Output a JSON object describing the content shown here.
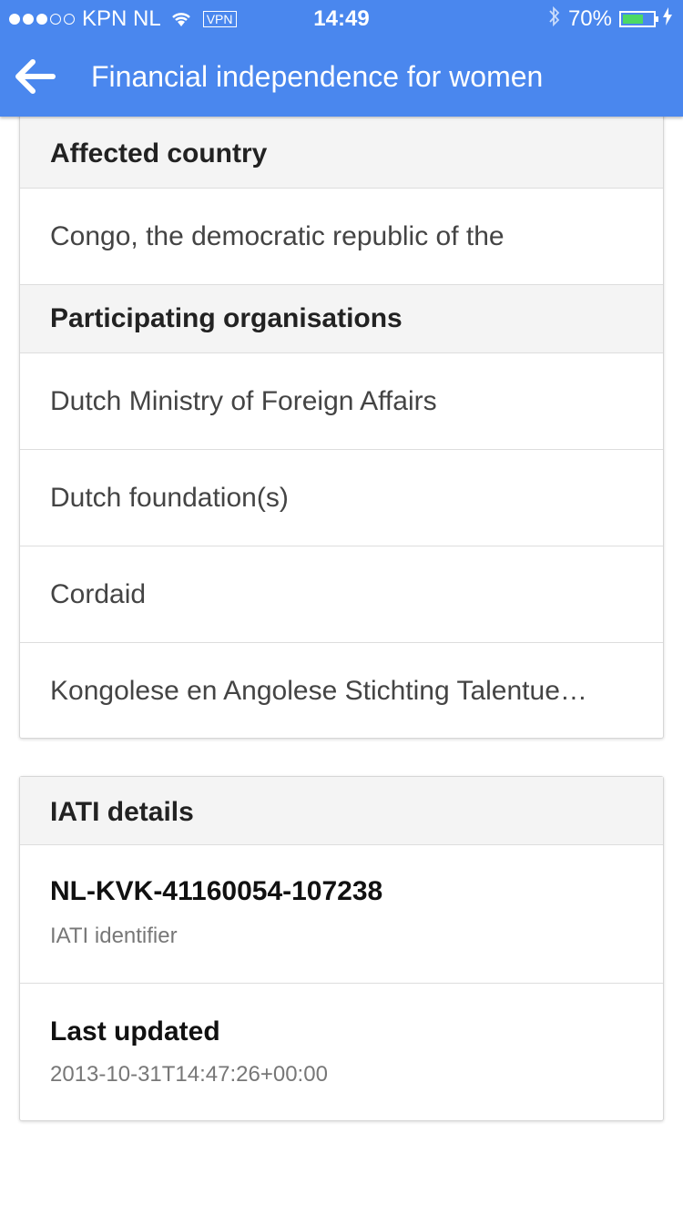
{
  "status_bar": {
    "carrier": "KPN NL",
    "vpn": "VPN",
    "time": "14:49",
    "battery": "70%",
    "battery_level": 0.7
  },
  "app_bar": {
    "title": "Financial independence for women"
  },
  "sections": {
    "affected_country": {
      "header": "Affected country",
      "value": "Congo, the democratic republic of the"
    },
    "participating": {
      "header": "Participating organisations",
      "items": [
        "Dutch Ministry of Foreign Affairs",
        "Dutch foundation(s)",
        "Cordaid",
        "Kongolese en Angolese Stichting Talentue…"
      ]
    },
    "iati": {
      "header": "IATI details",
      "identifier_value": "NL-KVK-41160054-107238",
      "identifier_label": "IATI identifier",
      "updated_label": "Last updated",
      "updated_value": "2013-10-31T14:47:26+00:00"
    }
  },
  "colors": {
    "app_bar": "#4a87ee",
    "battery_fill": "#4cd964",
    "section_header_bg": "#f4f4f4"
  }
}
